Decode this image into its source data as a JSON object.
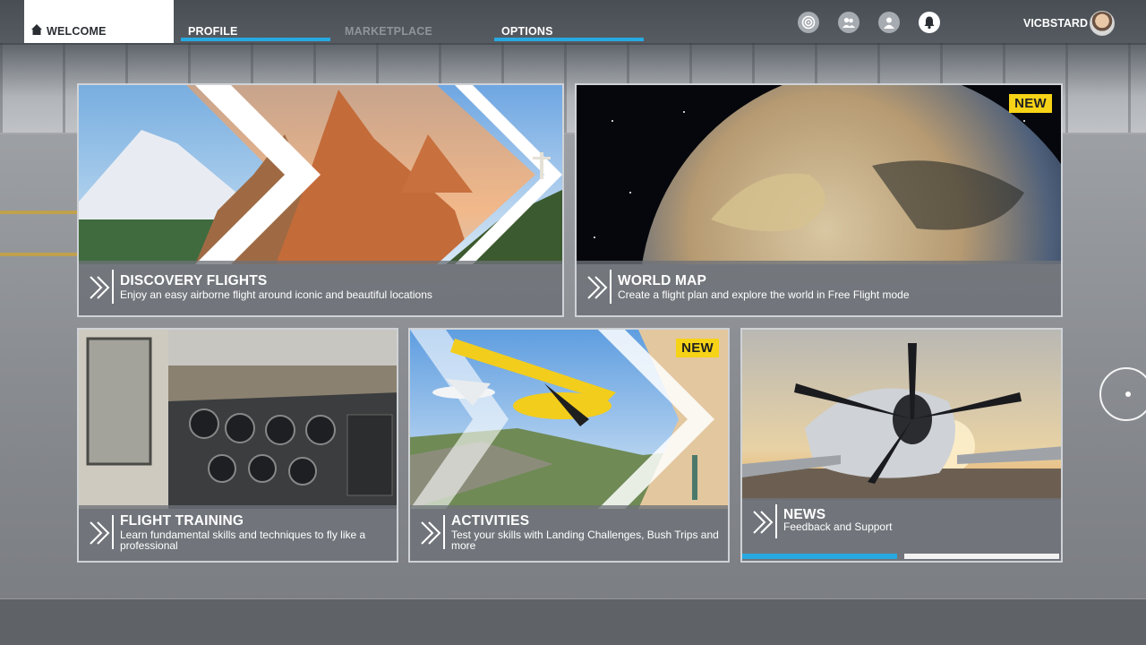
{
  "nav": {
    "tabs": [
      {
        "label": "WELCOME",
        "state": "active"
      },
      {
        "label": "PROFILE",
        "state": "normal"
      },
      {
        "label": "MARKETPLACE",
        "state": "disabled"
      },
      {
        "label": "OPTIONS",
        "state": "normal"
      }
    ],
    "icons": [
      "activity-icon",
      "friends-icon",
      "user-icon",
      "bell-icon"
    ],
    "username": "VICBSTARD"
  },
  "tiles": {
    "discovery": {
      "title": "DISCOVERY FLIGHTS",
      "description": "Enjoy an easy airborne flight around iconic and beautiful locations"
    },
    "world_map": {
      "title": "WORLD MAP",
      "description": "Create a flight plan and explore the world in Free Flight mode",
      "badge": "NEW"
    },
    "training": {
      "title": "FLIGHT TRAINING",
      "description": "Learn fundamental skills and techniques to fly like a professional"
    },
    "activities": {
      "title": "ACTIVITIES",
      "description": "Test your skills with Landing Challenges, Bush Trips and more",
      "badge": "NEW"
    },
    "news": {
      "title": "NEWS",
      "description": "Feedback and Support",
      "carousel_progress": 0.5
    }
  },
  "colors": {
    "accent": "#27a9e1",
    "badge": "#f6d316",
    "caption_bg": "#6e7278"
  }
}
